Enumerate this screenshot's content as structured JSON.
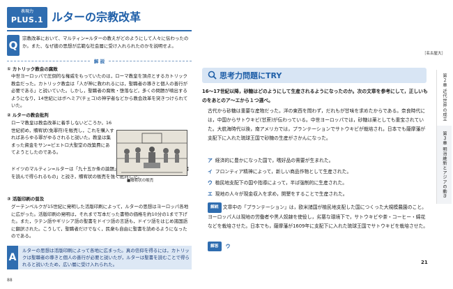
{
  "left": {
    "header": {
      "tag_small": "表現力",
      "tag_big": "PLUS.1",
      "title": "ルターの宗教改革"
    },
    "question": {
      "mark": "Q",
      "text": "宗教改革において、マルティン=ルターの教えがどのようにして人々に伝わったのか。また、なぜ彼の思想が広範な社会層に受け入れられたのかを説明せよ。",
      "source": "［名古屋大］"
    },
    "kaisetsu_label": "解 説",
    "sections": [
      {
        "heading": "① カトリック教会の腐敗",
        "body": "中世ヨーロッパで圧倒的な権威をもっていたのは，ローマ教皇を頂点とするカトリック教会だった。カトリック教会は「人が神に救われるには，聖職者の導きと個人の善行が必要である」と説いていた。しかし，聖職者の腐敗・堕落など，多くの問題が噴出するようになり，14世紀にはボヘミア(チェコ)の神学者などから教会改革を突きつけられていた。"
      },
      {
        "heading": "② ルターの教会批判",
        "body": "ローマ教皇は教会改革に着手しないどころか，16世紀初め，贖宥状(免罪符)を販売し，これを購入すればあらゆる罪がゆるされると説いた。教皇は集まった資金をサン=ピエトロ大聖堂の改築費にあてようとしたのである。",
        "body2": "ドイツのマルティン=ルターは「九十五か条の論題」を発表し，「真の信仰は信徒が聖書を読んで得られるもの」と説き，贖宥状の販売を強く批判した。"
      },
      {
        "heading": "③ 活版印刷の普及",
        "body": "グーテンベルクが15世紀に発明した活版印刷によって，ルターの思想はヨーロッパ各地に広がった。活版印刷の発明は，それまで写本だった書物の価格を約10分の1まで下げた。また，ラテン語やギリシア語の聖書をドイツ語の言語も，ドイツ語をはじめ諸国語に翻訳された。こうして，聖職者だけでなく，民衆も自由に聖書を読めるようになったのである。"
      }
    ],
    "woodcut_caption": "■贖宥状の販売",
    "answer": {
      "mark": "A",
      "text": "ルターの思想は活版印刷によって各地に広まった。真の信仰を得るには，カトリックは聖職者の導きと個人の善行が必要と説いたが，ルターは聖書を読むことで得られると説いたため，広い層に受け入れられた。"
    },
    "page_number": "88"
  },
  "right": {
    "try_title": "思考力問題にTRY",
    "question": "16〜17世紀以降，砂糖はどのようにして生産されるようになったのか。次の文章を参考にして，正しいものをあとのア〜エから１つ選べ。",
    "body": "古代から砂糖は重要な産物だった。洋の東西を問わず，だれもが甘味を求めたからである。奈良時代には，中国からサトウキビ(甘蔗)が伝わっている。中世ヨーロッパでは，砂糖は薬としても重宝されていた。大航海時代以後，南アメリカでは，プランテーションでサトウキビが栽培され，日本でも薩摩藩が支配下に入れた琉球王国で砂糖の生産がさかんになった。",
    "choices": [
      {
        "letter": "ア",
        "text": "経済的に豊かになった国で，嗜好品の需要が生まれた。"
      },
      {
        "letter": "イ",
        "text": "フロンティア精神によって，新しい商品作物として生産された。"
      },
      {
        "letter": "ウ",
        "text": "植民地支配下の国や指導によって，半ば強制的に生産された。"
      },
      {
        "letter": "エ",
        "text": "現地の人々が現金収入を求め，開墾をすることで生産された。"
      }
    ],
    "kaisetsu_tag": "解説",
    "kaisetsu_text": "文章中の「プランテーション」は，欧米諸国が植民地支配した国につくった大規模農園のこと。ヨーロッパ人は現地の労働者や黒人奴隷を使役し，劣悪な環境下で，サトウキビや茶・コーヒー・綿花などを栽培させた。日本でも，薩摩藩が1609年に支配下に入れた琉球王国でサトウキビを栽培させた。",
    "answer_tag": "解答",
    "answer_letter": "ウ",
    "page_number": "21",
    "side_tabs": [
      "第２章 近代世界の成立",
      "第３章 明治維新とアジアの動き"
    ]
  },
  "colors": {
    "accent": "#2f6db0",
    "answer_bg": "#dde8f5",
    "try_bg": "#d8e5f4"
  }
}
